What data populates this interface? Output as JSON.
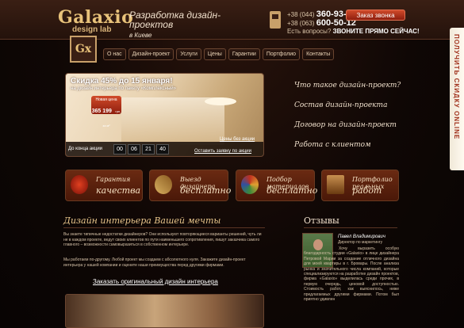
{
  "header": {
    "logo": "Galaxio",
    "logo_sub": "design lab",
    "emblem": "Gx",
    "tagline": "Разработка дизайн-проектов",
    "tagline_sub": "в Киеве",
    "phone1_code": "+38 (044)",
    "phone1": "360-93-90",
    "phone2_code": "+38 (063)",
    "phone2": "600-50-12",
    "order_call": "Заказ звонка",
    "question": "Есть вопросы?",
    "question_cta": "ЗВОНИТЕ ПРЯМО СЕЙЧАС!"
  },
  "nav": [
    "О нас",
    "Дизайн-проект",
    "Услуги",
    "Цены",
    "Гарантии",
    "Портфолио",
    "Контакты"
  ],
  "side_tab": "ПОЛУЧИТЬ СКИДКУ ONLINE",
  "hero": {
    "promo": "Скидка 45% до 15 января!",
    "promo_sub": "на дизайн интерьера по пакету «Комплексный»",
    "price_label": "Новая цена",
    "price": "365 199",
    "price_unit": "грн. за м²",
    "until": "До конца акции",
    "timer": [
      "00",
      "06",
      "21",
      "40"
    ],
    "link_prices": "Цены без акции",
    "link_request": "Оставить заявку по акции"
  },
  "right_links": [
    "Что такое дизайн-проект?",
    "Состав дизайн-проекта",
    "Договор на дизайн-проект",
    "Работа с клиентом"
  ],
  "features": [
    {
      "t1": "Гарантия",
      "t2": "качества"
    },
    {
      "t1": "Выезд дизайнера",
      "t2": "бесплатно"
    },
    {
      "t1": "Подбор материалов",
      "t2": "бесплатно"
    },
    {
      "t1": "Портфолио реальных",
      "t2": "работ"
    }
  ],
  "main": {
    "heading": "Дизайн интерьера Вашей мечты",
    "p1": "Вы знаете типичные недостатки дизайнеров? Они используют повторяющиеся варианты решений, чуть ли не в каждом проекте, ведут своих клиентов по пути наименьшего сопротивления, пишут заказчика самого главного – возможности самовыразиться в собственном интерьере.",
    "p2": "Мы работаем по-другому. Любой проект мы создаем с абсолютного нуля. Закажите дизайн-проект интерьера у нашей компании и оцените наши преимущества перед другими фирмами.",
    "order_link": "Заказать оригинальный дизайн интерьера"
  },
  "reviews": {
    "title": "Отзывы",
    "name": "Павел Владимирович",
    "role": "Директор по маркетингу",
    "text": "Хочу выразить особую благодарность студии «Galaxio» в лице дизайнера Петровой Марии за создание отличного дизайна для моей квартиры в г. Бровары. После анализа рынка и значительного числа компаний, которые специализируются на разработке дизайн проектов, фирма «Galaxio» выделилась среди прочих, в первую очередь, ценовой доступностью. Стоимость работ, как выяснилось, ниже предлагаемых другими фирмами. Потом был приятно удивлен"
  }
}
